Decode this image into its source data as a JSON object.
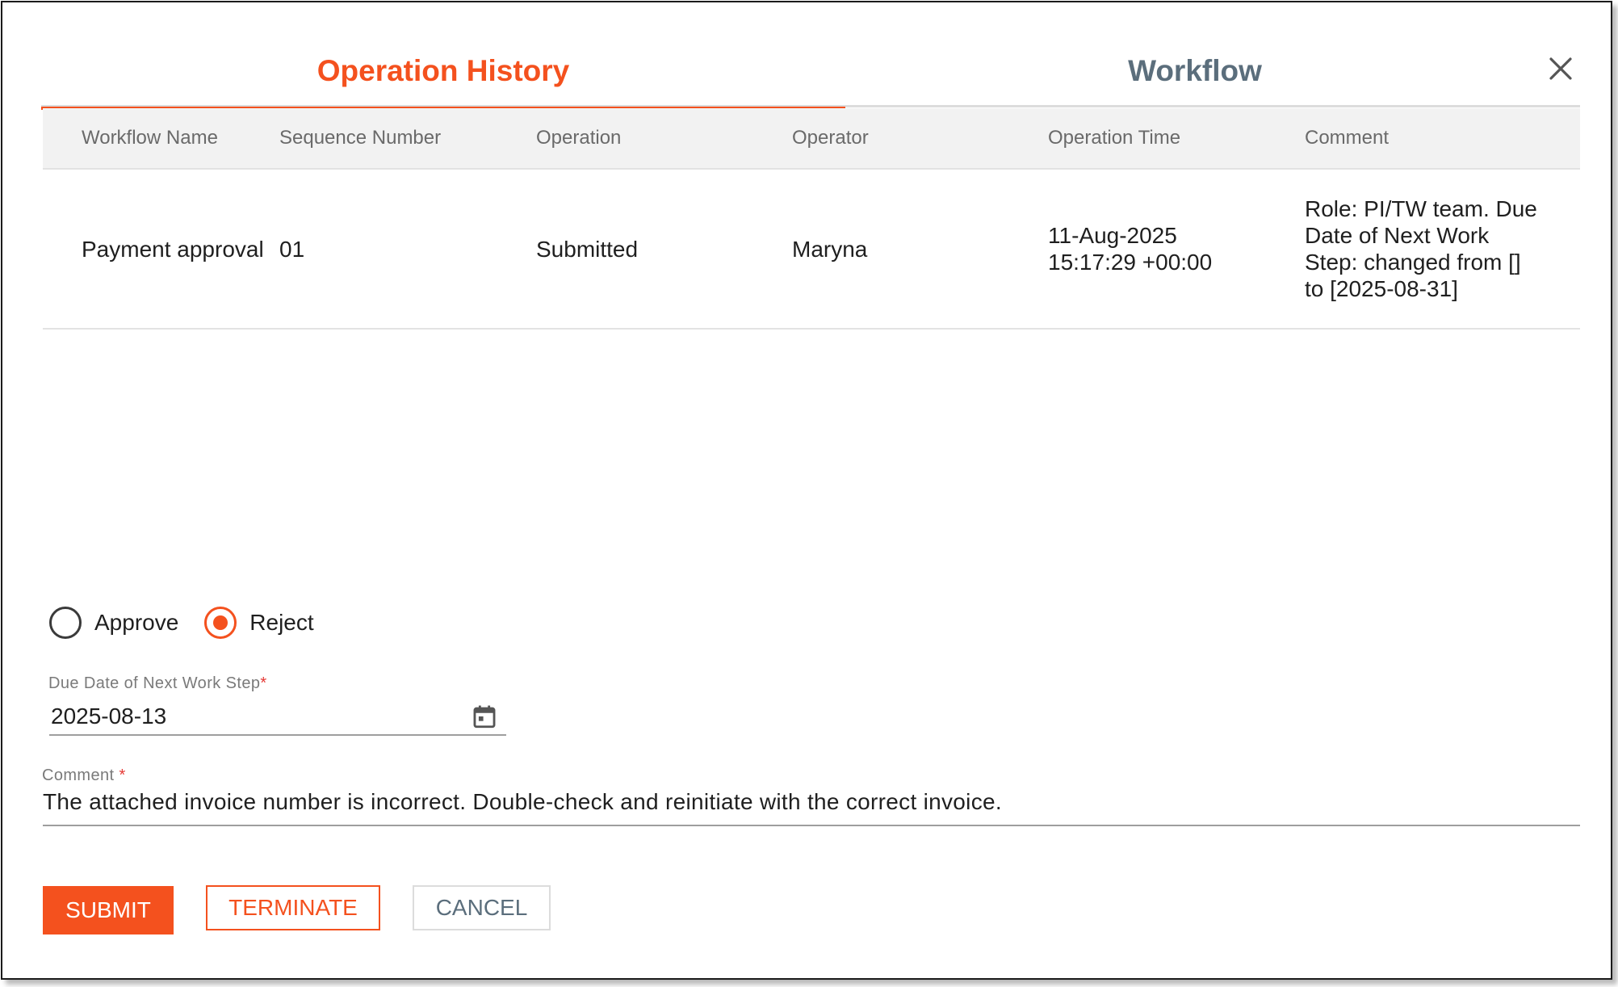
{
  "tabs": [
    {
      "label": "Operation History",
      "active": true
    },
    {
      "label": "Workflow",
      "active": false
    }
  ],
  "close_icon": "close-icon",
  "table": {
    "headers": [
      "Workflow Name",
      "Sequence Number",
      "Operation",
      "Operator",
      "Operation Time",
      "Comment"
    ],
    "rows": [
      {
        "workflow_name": "Payment approval",
        "sequence_number": "01",
        "operation": "Submitted",
        "operator": "Maryna",
        "operation_time_date": "11-Aug-2025",
        "operation_time_time": "15:17:29 +00:00",
        "comment": "Role: PI/TW team. Due Date of Next Work Step: changed from [] to [2025-08-31]"
      }
    ]
  },
  "decision": {
    "options": [
      {
        "label": "Approve",
        "checked": false
      },
      {
        "label": "Reject",
        "checked": true
      }
    ]
  },
  "due_date": {
    "label": "Due Date of Next Work Step",
    "required_mark": "*",
    "value": "2025-08-13",
    "icon": "calendar-icon"
  },
  "comment": {
    "label": "Comment",
    "required_mark": "*",
    "value": "The attached invoice number is incorrect. Double-check and reinitiate with the correct invoice."
  },
  "buttons": {
    "submit": "SUBMIT",
    "terminate": "TERMINATE",
    "cancel": "CANCEL"
  },
  "colors": {
    "accent": "#f4511e",
    "tab_inactive": "#5b6e7c",
    "header_bg": "#f2f2f2"
  }
}
